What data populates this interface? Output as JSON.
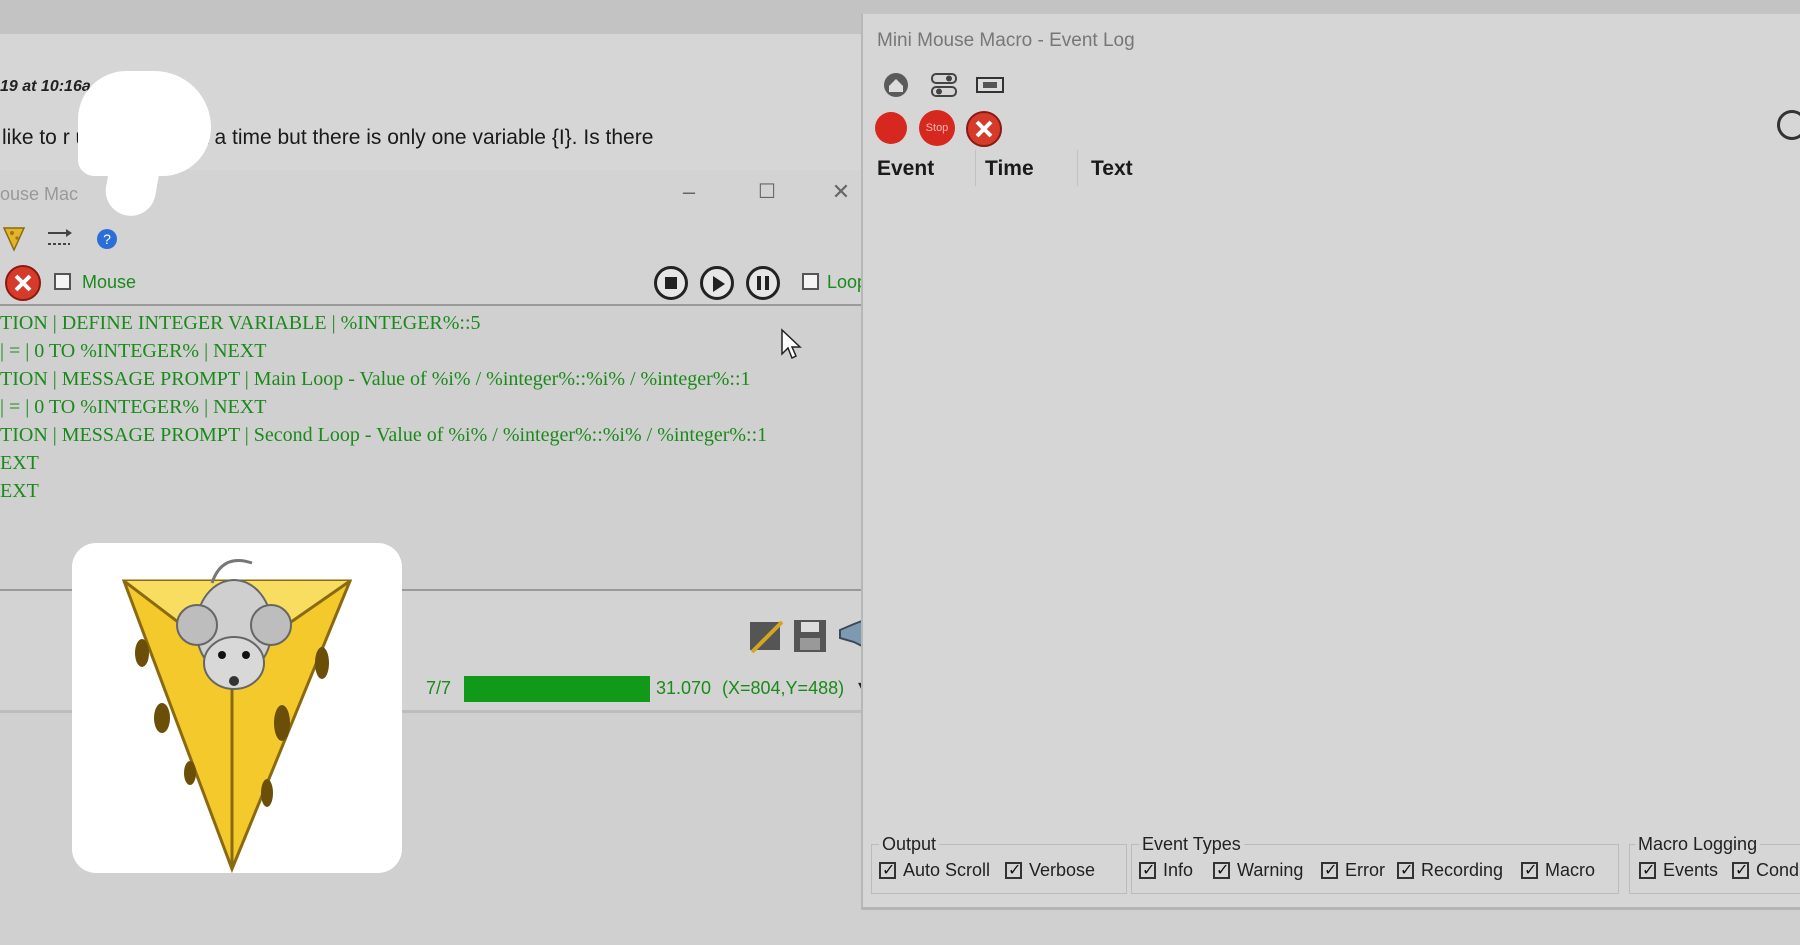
{
  "forum": {
    "timestamp": "19 at 10:16a",
    "post_text": "like to r          un one loop at a time but there is only one variable {I}. Is there"
  },
  "macro_window": {
    "title": "ouse Mac",
    "minimize": "–",
    "maximize": "☐",
    "close": "✕",
    "mouse_checkbox_label": "Mouse",
    "loop_checkbox_label": "Loop",
    "script_lines": [
      "TION | DEFINE INTEGER VARIABLE | %INTEGER%::5",
      "| = | 0 TO %INTEGER% | NEXT",
      "TION | MESSAGE PROMPT | Main Loop - Value of %i% / %integer%::%i% / %integer%::1",
      "| = | 0 TO %INTEGER% | NEXT",
      "TION | MESSAGE PROMPT | Second Loop - Value of %i% / %integer%::%i% / %integer%::1",
      "EXT",
      "EXT"
    ],
    "status": {
      "count": "7/7",
      "progress_fraction": 1.0,
      "time": "31.070",
      "coords": "(X=804,Y=488)",
      "dropdown": "▾"
    }
  },
  "event_log": {
    "title": "Mini Mouse Macro - Event Log",
    "columns": [
      "Event",
      "Time",
      "Text"
    ],
    "stop_icon_text": "Stop",
    "groups": {
      "output": {
        "label": "Output",
        "options": [
          "Auto Scroll",
          "Verbose"
        ]
      },
      "event_types": {
        "label": "Event Types",
        "options": [
          "Info",
          "Warning",
          "Error",
          "Recording",
          "Macro"
        ]
      },
      "macro_logging": {
        "label": "Macro Logging",
        "options": [
          "Events",
          "Cond"
        ]
      }
    }
  },
  "colors": {
    "script_text": "#1a8a1a",
    "progress": "#119a19",
    "record_red": "#d6281e"
  }
}
